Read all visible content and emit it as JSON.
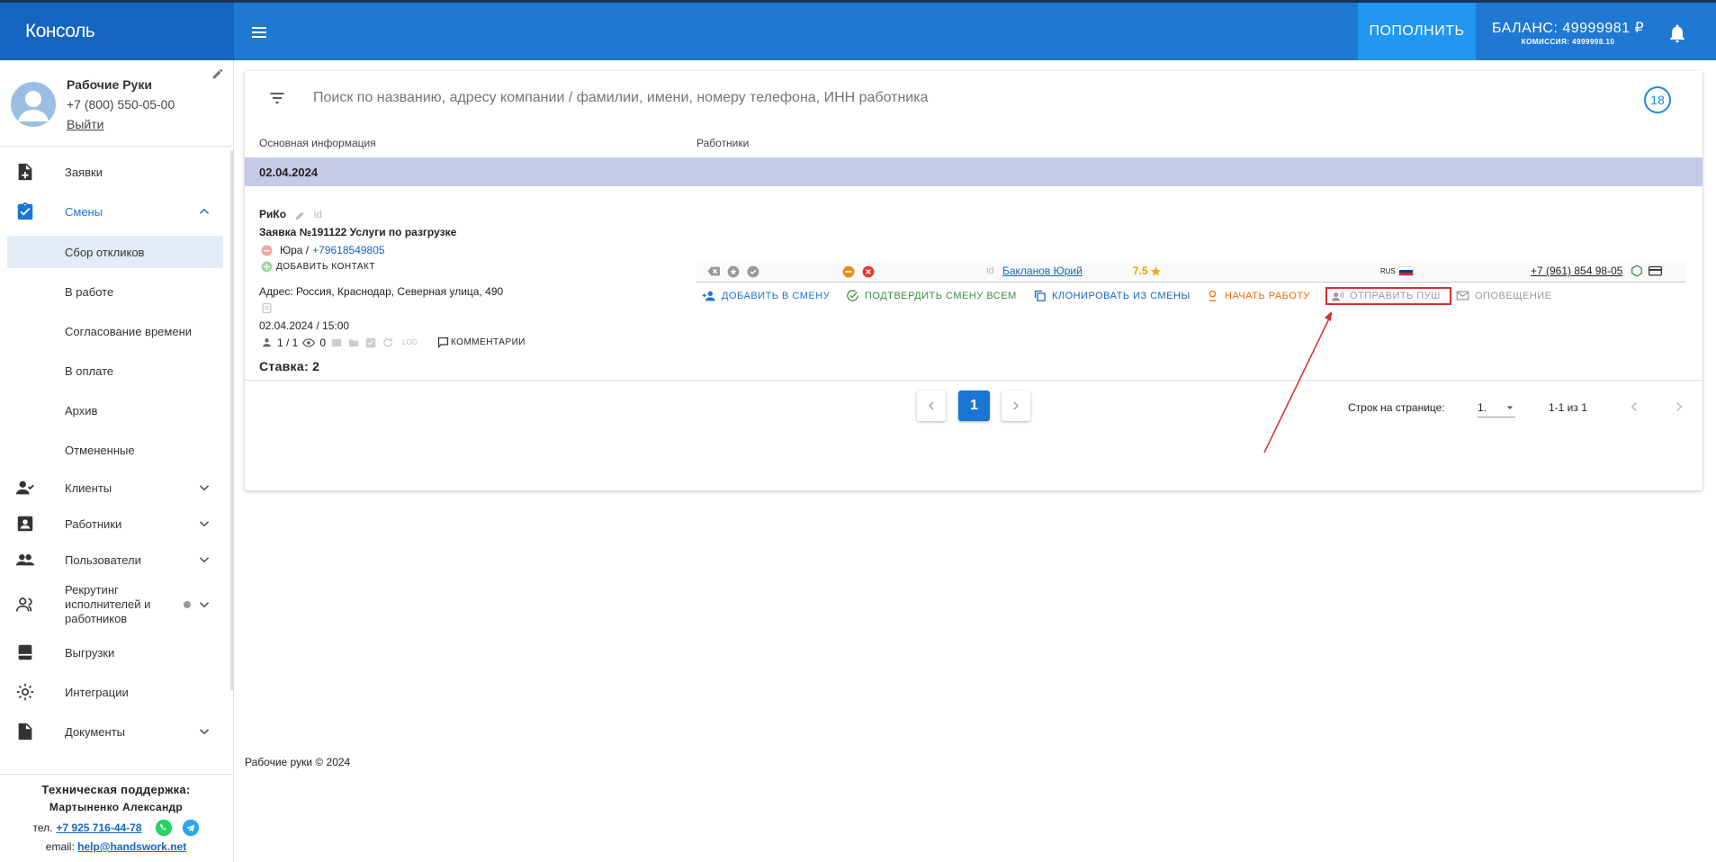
{
  "header": {
    "logo": "Консоль",
    "topup_label": "ПОПОЛНИТЬ",
    "balance": "БАЛАНС: 49999981 ₽",
    "commission": "КОМИССИЯ: 4999998.10"
  },
  "profile": {
    "name": "Рабочие Руки",
    "phone": "+7 (800) 550-05-00",
    "logout": "Выйти"
  },
  "sidebar": {
    "items": [
      {
        "label": "Заявки",
        "icon": "document-add-icon"
      },
      {
        "label": "Смены",
        "icon": "clipboard-check-icon"
      },
      {
        "label": "Клиенты",
        "icon": "person-check-icon"
      },
      {
        "label": "Работники",
        "icon": "badge-icon"
      },
      {
        "label": "Пользователи",
        "icon": "people-icon"
      },
      {
        "label": "Рекрутинг исполнителей и работников",
        "icon": "recruit-icon"
      },
      {
        "label": "Выгрузки",
        "icon": "archive-icon"
      },
      {
        "label": "Интеграции",
        "icon": "gear-icon"
      },
      {
        "label": "Документы",
        "icon": "file-icon"
      }
    ],
    "shift_sub": [
      "Сбор откликов",
      "В работе",
      "Согласование времени",
      "В оплате",
      "Архив",
      "Отмененные"
    ]
  },
  "support": {
    "title": "Техническая поддержка:",
    "person": "Мартыненко Александр",
    "phone_prefix": "тел.",
    "phone": "+7 925 716-44-78",
    "email_prefix": "email:",
    "email": "help@handswork.net"
  },
  "search": {
    "placeholder": "Поиск по названию, адресу компании / фамилии, имени, номеру телефона, ИНН работника",
    "count": "18"
  },
  "table": {
    "col1": "Основная информация",
    "col2": "Работники",
    "date_group": "02.04.2024"
  },
  "order": {
    "company": "РиКо",
    "id_label": "id",
    "title": "Заявка №191122 Услуги по разгрузке",
    "contact_name": "Юра /",
    "contact_phone": "+79618549805",
    "add_contact": "ДОБАВИТЬ КОНТАКТ",
    "address": "Адрес: Россия, Краснодар, Северная улица, 490",
    "datetime": "02.04.2024 / 15:00",
    "workers": "1 / 1",
    "views": "0",
    "log": "LOG",
    "comments": "КОММЕНТАРИИ",
    "rate": "Ставка: 2"
  },
  "worker": {
    "id_label": "id",
    "name": "Бакланов Юрий",
    "rating": "7.5",
    "country": "RUS",
    "phone": "+7 (961) 854 98-05"
  },
  "actions": {
    "add_to_shift": "ДОБАВИТЬ В СМЕНУ",
    "confirm_all": "ПОДТВЕРДИТЬ СМЕНУ ВСЕМ",
    "clone": "КЛОНИРОВАТЬ ИЗ СМЕНЫ",
    "start": "НАЧАТЬ РАБОТУ",
    "send_push": "ОТПРАВИТЬ ПУШ",
    "notify": "ОПОВЕЩЕНИЕ"
  },
  "pagination": {
    "rows_label": "Строк на странице:",
    "rows_value": "1.",
    "range": "1-1 из 1",
    "current_page": "1"
  },
  "footer": "Рабочие руки © 2024",
  "colors": {
    "primary": "#1f78d1",
    "accent": "#2196f3",
    "date_row": "#c5cae9",
    "highlight": "#d32f2f"
  }
}
